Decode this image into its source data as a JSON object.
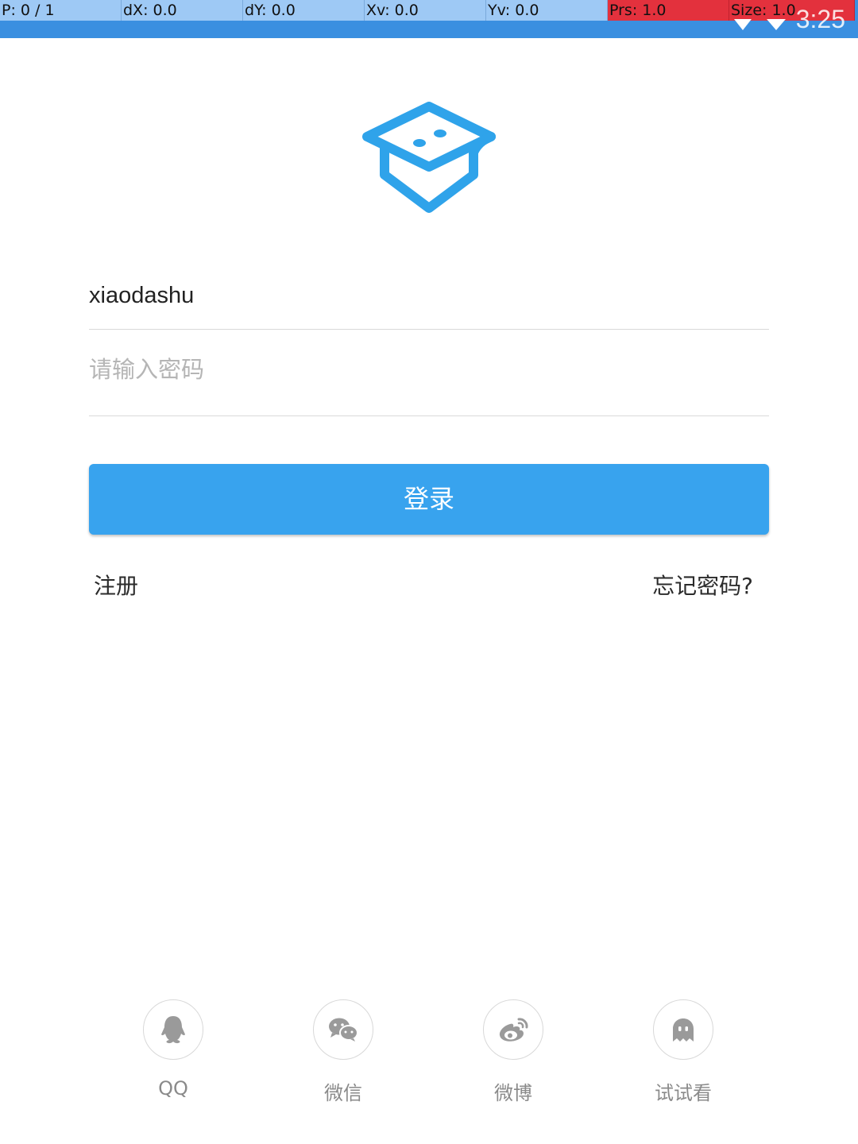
{
  "debug_overlay": {
    "p": "P: 0 / 1",
    "dx": "dX: 0.0",
    "dy": "dY: 0.0",
    "xv": "Xv: 0.0",
    "yv": "Yv: 0.0",
    "prs": "Prs: 1.0",
    "size": "Size: 1.0"
  },
  "status_bar": {
    "time": "3:25",
    "icons": [
      "signal-icon",
      "wifi-icon"
    ]
  },
  "logo": {
    "icon": "graduation-cap-icon",
    "color": "#2fa3ea"
  },
  "login_form": {
    "username_value": "xiaodashu",
    "password_placeholder": "请输入密码",
    "login_label": "登录",
    "register_label": "注册",
    "forgot_label": "忘记密码?"
  },
  "social_login": [
    {
      "label": "QQ",
      "icon": "qq-icon"
    },
    {
      "label": "微信",
      "icon": "wechat-icon"
    },
    {
      "label": "微博",
      "icon": "weibo-icon"
    },
    {
      "label": "试试看",
      "icon": "ghost-icon"
    }
  ],
  "colors": {
    "primary": "#38a3ee",
    "status_bar": "#3a8fe0",
    "icon_gray": "#9a9a9a"
  }
}
